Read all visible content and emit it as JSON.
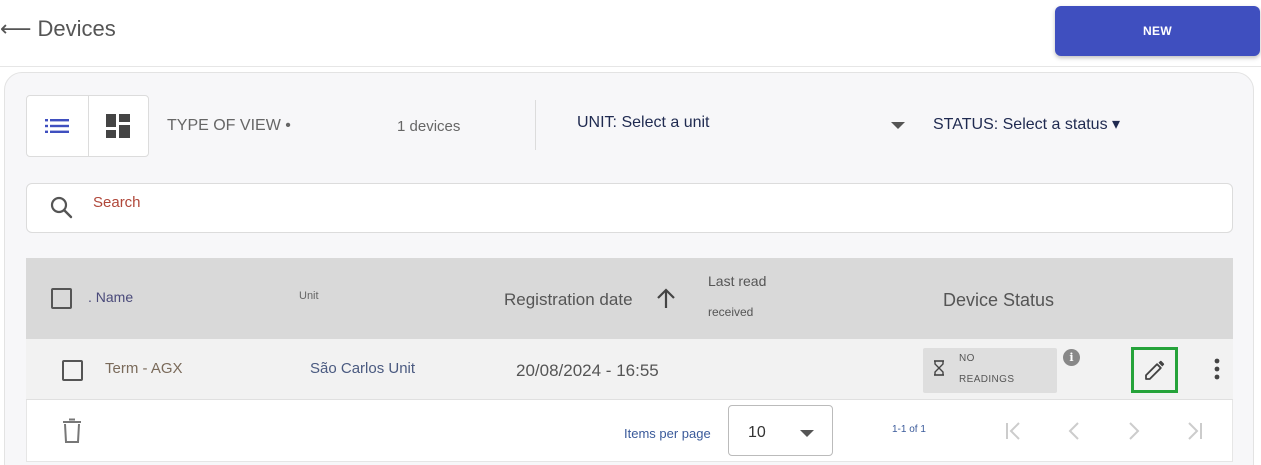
{
  "header": {
    "back_arrow": "⟵",
    "title": "Devices",
    "new_button": "NEW"
  },
  "toolbar": {
    "list_view_icon": "list-icon",
    "grid_view_icon": "dashboard-icon",
    "type_of_view": "TYPE OF VIEW •",
    "devices_count": "1 devices",
    "unit_select": "UNIT: Select a unit",
    "status_select": "STATUS: Select a status ▾"
  },
  "search": {
    "placeholder": "Search"
  },
  "table": {
    "columns": {
      "name": ". Name",
      "unit": "Unit",
      "registration_date": "Registration date",
      "last_read_line1": "Last read",
      "last_read_line2": "received",
      "device_status": "Device Status"
    },
    "rows": [
      {
        "name": "Term - AGX",
        "unit": "São Carlos Unit",
        "registration_date": "20/08/2024 - 16:55",
        "last_read": "",
        "status_line1": "NO",
        "status_line2": "READINGS",
        "info": "i"
      }
    ]
  },
  "footer": {
    "items_per_page_label": "Items per page",
    "items_per_page_value": "10",
    "range": "1-1 of 1"
  },
  "colors": {
    "accent": "#3f4fbf",
    "highlight": "#25a33a"
  }
}
